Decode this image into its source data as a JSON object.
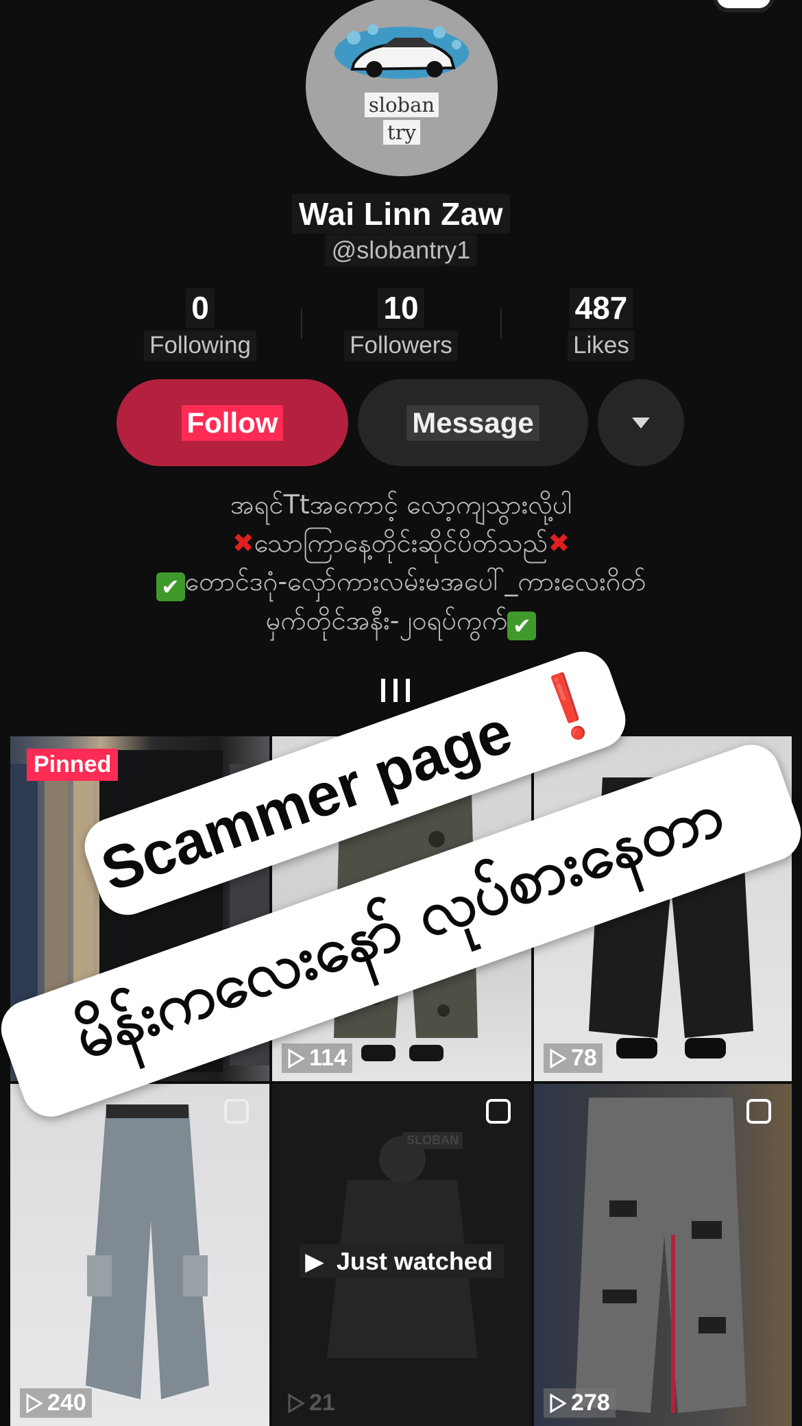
{
  "profile": {
    "avatar_text_line1": "sloban",
    "avatar_text_line2": "try",
    "display_name": "Wai Linn Zaw",
    "username": "@slobantry1"
  },
  "stats": [
    {
      "value": "0",
      "label": "Following"
    },
    {
      "value": "10",
      "label": "Followers"
    },
    {
      "value": "487",
      "label": "Likes"
    }
  ],
  "actions": {
    "follow_label": "Follow",
    "message_label": "Message",
    "more_icon": "caret-down-icon"
  },
  "bio": {
    "line1": "အရင်Ttအကောင့် လော့ကျသွားလို့ပါ",
    "line2_text": "သောကြာနေ့တိုင်းဆိုင်ပိတ်သည်",
    "line3_text": "တောင်ဒဂုံ-လှော်ကားလမ်းမအပေါ်_ကားလေးဂိတ်",
    "line4_text": "မှက်တိုင်အနီး-၂၀ရပ်ကွက်",
    "x_glyph": "✖",
    "check_glyph": "✔"
  },
  "videos": [
    {
      "badge": "Pinned",
      "views": ""
    },
    {
      "views": "114"
    },
    {
      "views": "78"
    },
    {
      "views": "240"
    },
    {
      "overlay": "Just watched",
      "views": "21",
      "watermark": "SLOBAN"
    },
    {
      "views": "278"
    }
  ],
  "overlays": {
    "banner1_text": "Scammer page",
    "banner1_mark": "❗",
    "banner2_text": "မိန်းကလေးနော် လုပ်စားနေတာ"
  },
  "colors": {
    "follow": "#fe2c55",
    "background": "#0e0e0e",
    "warning_red": "#e3191f",
    "check_green": "#3f9a2b"
  }
}
